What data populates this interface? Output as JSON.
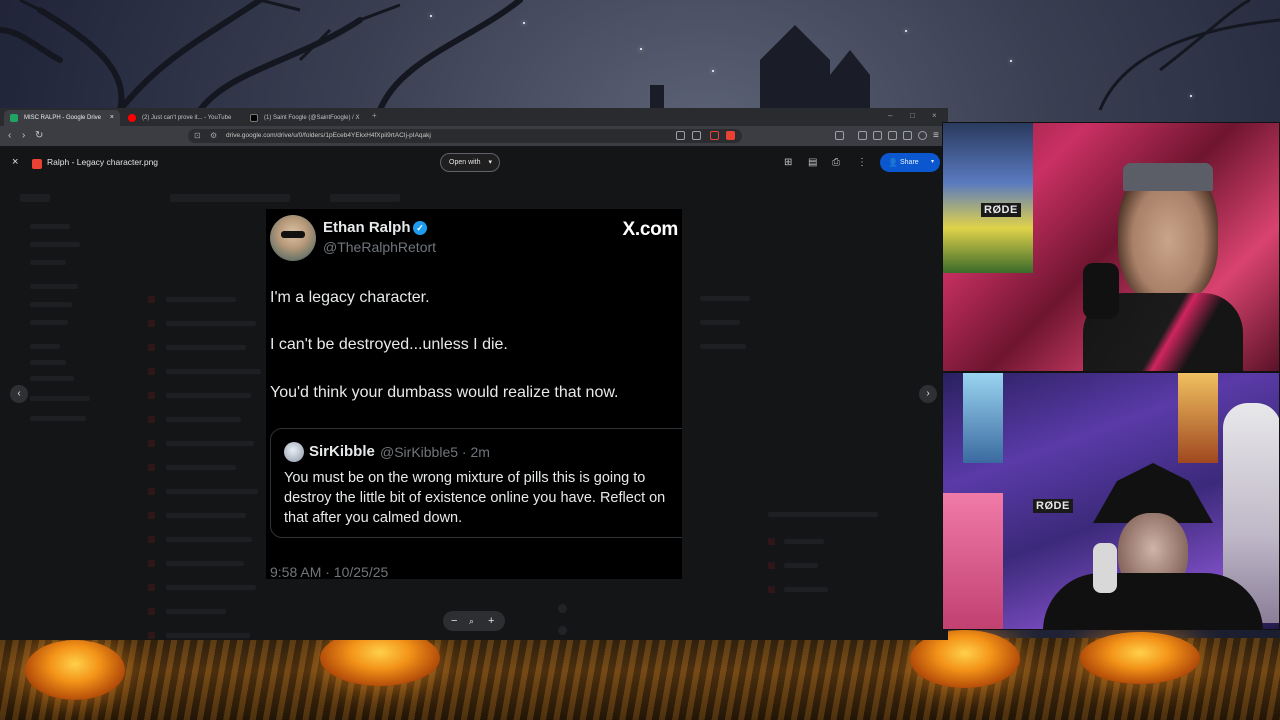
{
  "browser": {
    "tabs": [
      {
        "title": "MISC RALPH - Google Drive",
        "favicon_color": "#1fa463",
        "active": true
      },
      {
        "title": "(2) Just can't prove it... - YouTube",
        "favicon_color": "#ff0000",
        "active": false
      },
      {
        "title": "(1) Saint Foogle (@SaintFoogle) / X",
        "favicon_color": "#000000",
        "active": false
      }
    ],
    "new_tab": "+",
    "address": "drive.google.com/drive/u/0/folders/1pEceb4YEkxH4fXpii9rtACIj-pIAqakj"
  },
  "viewer": {
    "close_icon": "×",
    "file_name": "Ralph - Legacy character.png",
    "open_with_label": "Open with",
    "share_label": "Share",
    "prev_arrow": "‹",
    "next_arrow": "›",
    "zoom_out": "−",
    "zoom_in": "+"
  },
  "tweet": {
    "author_name": "Ethan Ralph",
    "author_handle": "@TheRalphRetort",
    "brand": "X.com",
    "lines": [
      "I'm a legacy character.",
      "I can't be destroyed...unless I die.",
      "You'd think your dumbass would realize that now."
    ],
    "quote": {
      "name": "SirKibble",
      "meta": "@SirKibble5 · 2m",
      "text": "You must be on the wrong mixture of pills this is going to destroy the little bit of existence online you have. Reflect on that after you calmed down."
    },
    "timestamp": "9:58 AM · 10/25/25"
  },
  "webcams": {
    "mic_label": "RØDE"
  }
}
